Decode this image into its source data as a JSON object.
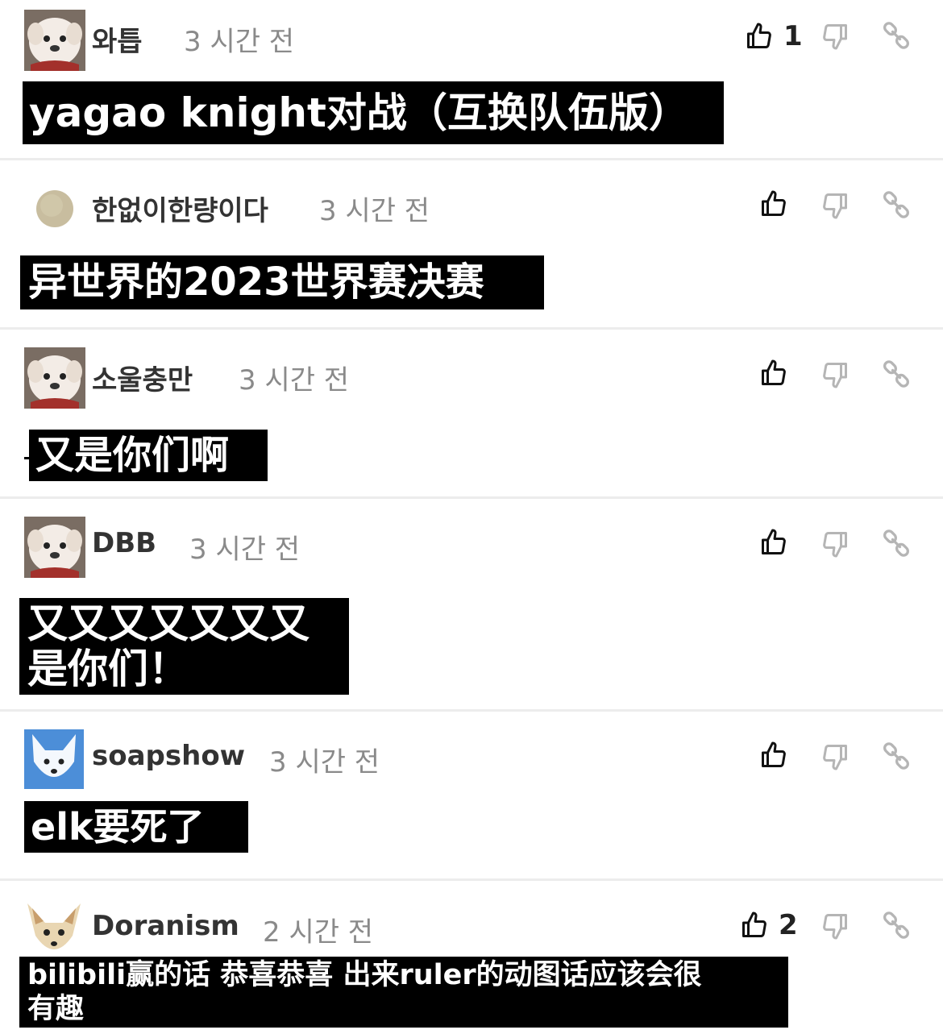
{
  "comments": [
    {
      "username": "와틉",
      "time": "3 시간 전",
      "likes": "1",
      "text": "yagao knight对战（互换队伍版）"
    },
    {
      "username": "한없이한량이다",
      "time": "3 시간 전",
      "likes": "",
      "text": "异世界的2023世界赛决赛"
    },
    {
      "username": "소울충만",
      "time": "3 시간 전",
      "likes": "",
      "text": "又是你们啊"
    },
    {
      "username": "DBB",
      "time": "3 시간 전",
      "likes": "",
      "text": "又又又又又又又\n是你们！"
    },
    {
      "username": "soapshow",
      "time": "3 시간 전",
      "likes": "",
      "text": "elk要死了"
    },
    {
      "username": "Doranism",
      "time": "2 시간 전",
      "likes": "2",
      "text": "bilibili赢的话 恭喜恭喜 出来ruler的动图话应该会很\n有趣"
    }
  ],
  "icons": {
    "like": "thumbs-up-icon",
    "dislike": "thumbs-down-icon",
    "link": "link-icon"
  },
  "colors": {
    "text_bg": "#000000",
    "text_fg": "#ffffff",
    "timestamp": "#8a8a8a",
    "icon_active": "#111111",
    "icon_muted": "#b5b5b5",
    "divider": "#ececec"
  }
}
